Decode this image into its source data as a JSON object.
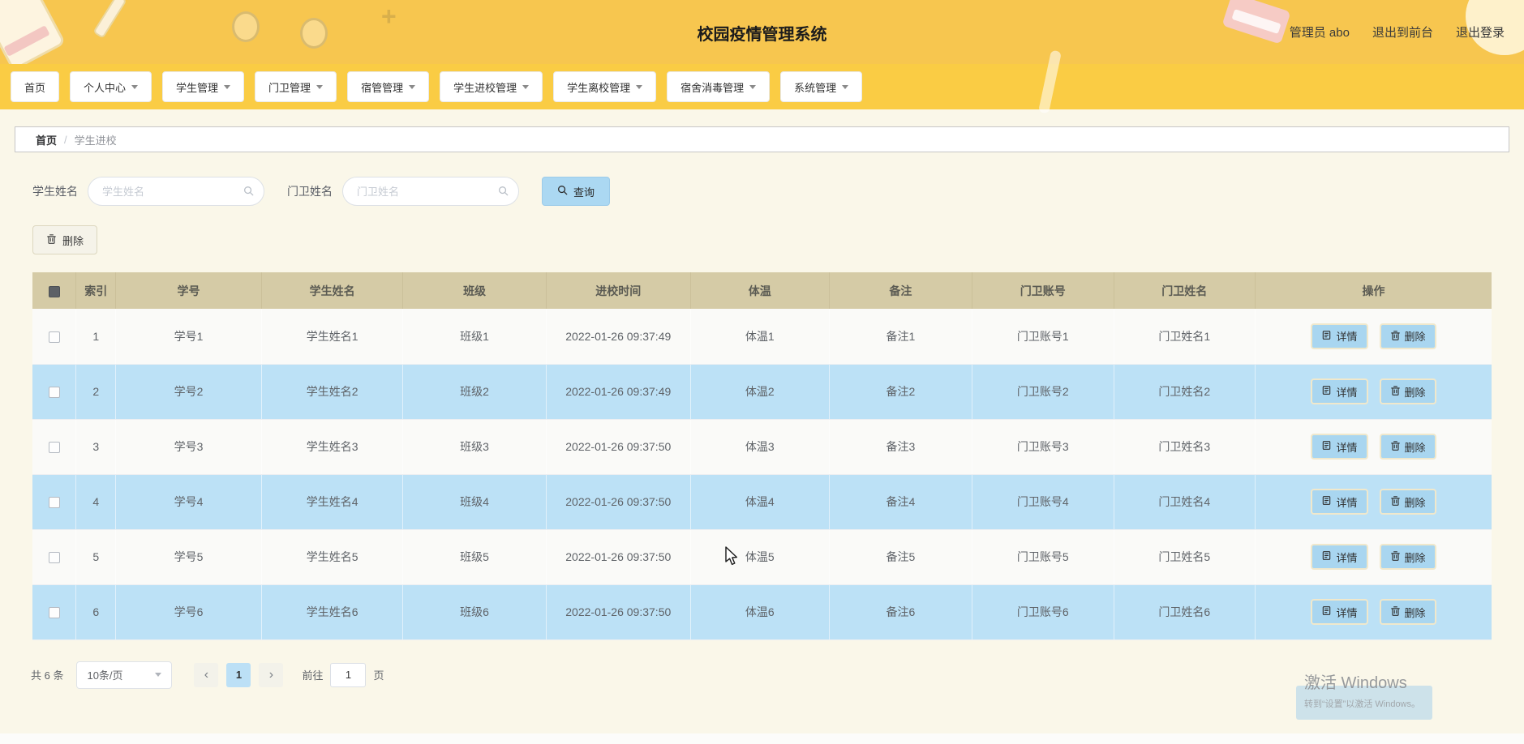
{
  "header": {
    "title": "校园疫情管理系统",
    "user": "管理员 abo",
    "links": {
      "exit_front": "退出到前台",
      "logout": "退出登录"
    }
  },
  "nav": {
    "items": [
      {
        "label": "首页",
        "dropdown": false
      },
      {
        "label": "个人中心",
        "dropdown": true
      },
      {
        "label": "学生管理",
        "dropdown": true
      },
      {
        "label": "门卫管理",
        "dropdown": true
      },
      {
        "label": "宿管管理",
        "dropdown": true
      },
      {
        "label": "学生进校管理",
        "dropdown": true
      },
      {
        "label": "学生离校管理",
        "dropdown": true
      },
      {
        "label": "宿舍消毒管理",
        "dropdown": true
      },
      {
        "label": "系统管理",
        "dropdown": true
      }
    ]
  },
  "breadcrumb": {
    "home": "首页",
    "separator": "/",
    "current": "学生进校"
  },
  "filters": {
    "student_name_label": "学生姓名",
    "student_name_placeholder": "学生姓名",
    "guard_name_label": "门卫姓名",
    "guard_name_placeholder": "门卫姓名",
    "search_button": "查询",
    "delete_button": "删除"
  },
  "table": {
    "columns": [
      "索引",
      "学号",
      "学生姓名",
      "班级",
      "进校时间",
      "体温",
      "备注",
      "门卫账号",
      "门卫姓名",
      "操作"
    ],
    "actions": {
      "detail": "详情",
      "delete": "删除"
    },
    "rows": [
      {
        "index": "1",
        "student_id": "学号1",
        "student_name": "学生姓名1",
        "class_name": "班级1",
        "entry_time": "2022-01-26 09:37:49",
        "temperature": "体温1",
        "remark": "备注1",
        "guard_account": "门卫账号1",
        "guard_name": "门卫姓名1"
      },
      {
        "index": "2",
        "student_id": "学号2",
        "student_name": "学生姓名2",
        "class_name": "班级2",
        "entry_time": "2022-01-26 09:37:49",
        "temperature": "体温2",
        "remark": "备注2",
        "guard_account": "门卫账号2",
        "guard_name": "门卫姓名2"
      },
      {
        "index": "3",
        "student_id": "学号3",
        "student_name": "学生姓名3",
        "class_name": "班级3",
        "entry_time": "2022-01-26 09:37:50",
        "temperature": "体温3",
        "remark": "备注3",
        "guard_account": "门卫账号3",
        "guard_name": "门卫姓名3"
      },
      {
        "index": "4",
        "student_id": "学号4",
        "student_name": "学生姓名4",
        "class_name": "班级4",
        "entry_time": "2022-01-26 09:37:50",
        "temperature": "体温4",
        "remark": "备注4",
        "guard_account": "门卫账号4",
        "guard_name": "门卫姓名4"
      },
      {
        "index": "5",
        "student_id": "学号5",
        "student_name": "学生姓名5",
        "class_name": "班级5",
        "entry_time": "2022-01-26 09:37:50",
        "temperature": "体温5",
        "remark": "备注5",
        "guard_account": "门卫账号5",
        "guard_name": "门卫姓名5"
      },
      {
        "index": "6",
        "student_id": "学号6",
        "student_name": "学生姓名6",
        "class_name": "班级6",
        "entry_time": "2022-01-26 09:37:50",
        "temperature": "体温6",
        "remark": "备注6",
        "guard_account": "门卫账号6",
        "guard_name": "门卫姓名6"
      }
    ]
  },
  "pagination": {
    "total": "共 6 条",
    "page_size": "10条/页",
    "current_page": "1",
    "goto_label": "前往",
    "goto_value": "1",
    "goto_unit": "页"
  },
  "watermark": {
    "line1": "激活 Windows",
    "line2": "转到“设置”以激活 Windows。"
  },
  "icons": {
    "search": "magnifier-icon",
    "detail": "document-icon",
    "delete": "trash-icon",
    "dropdown": "chevron-down-icon"
  },
  "colors": {
    "banner_yellow": "#F7C64F",
    "nav_yellow": "#FACC44",
    "table_header_tan": "#D5CBA6",
    "row_blue": "#BCE1F6",
    "accent_blue": "#ABD8F2",
    "page_cream": "#FAF7E9"
  }
}
